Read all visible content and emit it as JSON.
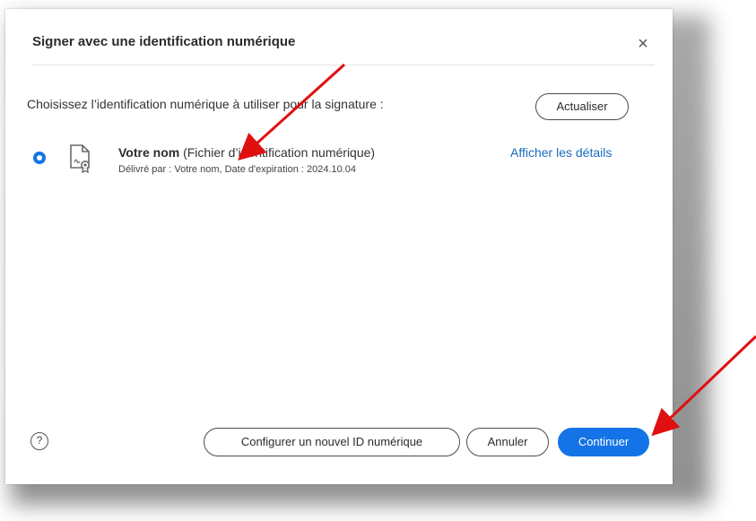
{
  "dialog": {
    "title": "Signer avec une identification numérique",
    "close_label": "×",
    "prompt": "Choisissez l’identification numérique à utiliser pour la signature :",
    "refresh_label": "Actualiser"
  },
  "identity": {
    "selected": true,
    "name": "Votre nom",
    "type": "(Fichier d’identification numérique)",
    "details": "Délivré par : Votre nom, Date d'expiration : 2024.10.04",
    "details_link": "Afficher les détails",
    "icon": "certificate-file-icon"
  },
  "footer": {
    "help_label": "?",
    "configure_label": "Configurer un nouvel ID numérique",
    "cancel_label": "Annuler",
    "continue_label": "Continuer"
  },
  "colors": {
    "accent": "#1473e6",
    "link": "#1a6bbd",
    "annotation_arrow": "#e01010"
  }
}
